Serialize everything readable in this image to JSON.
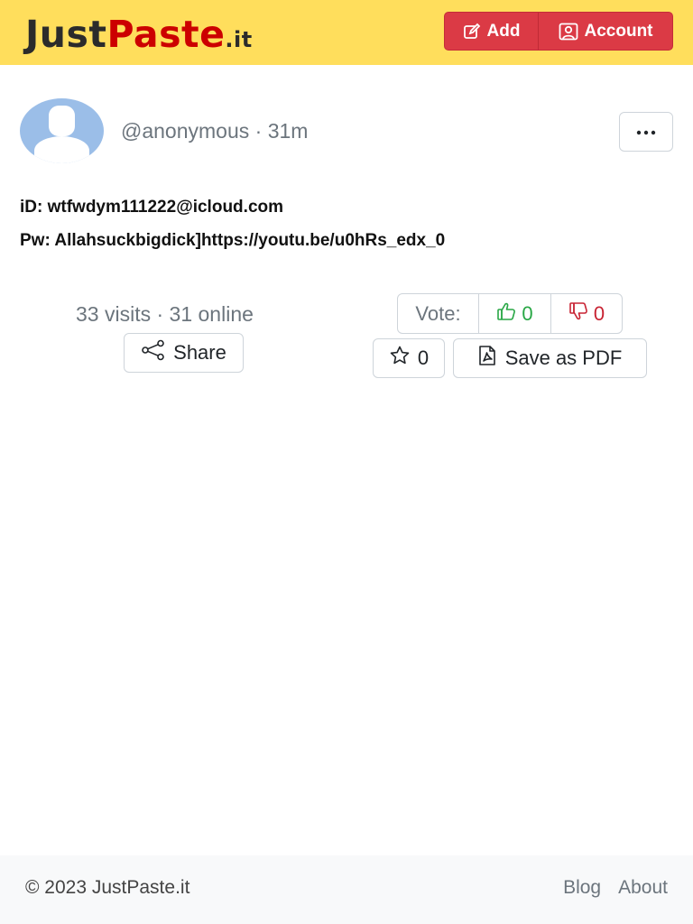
{
  "brand": {
    "just": "Just",
    "paste": "Paste",
    "tld": ".it"
  },
  "nav": {
    "add_label": "Add",
    "account_label": "Account"
  },
  "post": {
    "author": "@anonymous",
    "separator": "·",
    "age": "31m",
    "lines": [
      "iD: wtfwdym111222@icloud.com",
      "Pw: Allahsuckbigdick]https://youtu.be/u0hRs_edx_0"
    ]
  },
  "stats": {
    "visits": "33 visits",
    "separator": "·",
    "online": "31 online"
  },
  "actions": {
    "share_label": "Share",
    "vote_label": "Vote:",
    "upvotes": "0",
    "downvotes": "0",
    "favorites": "0",
    "pdf_label": "Save as PDF"
  },
  "footer": {
    "copyright": "© 2023 JustPaste.it",
    "links": [
      "Blog",
      "About"
    ]
  },
  "colors": {
    "header_bg": "#ffde5c",
    "brand_red": "#cc0000",
    "button_red": "#db3a45",
    "upvote_green": "#28a745",
    "downvote_red": "#c82333"
  },
  "icons": [
    "pencil-square-icon",
    "person-square-icon",
    "three-dots-icon",
    "share-icon",
    "thumbs-up-icon",
    "thumbs-down-icon",
    "star-icon",
    "file-pdf-icon"
  ]
}
